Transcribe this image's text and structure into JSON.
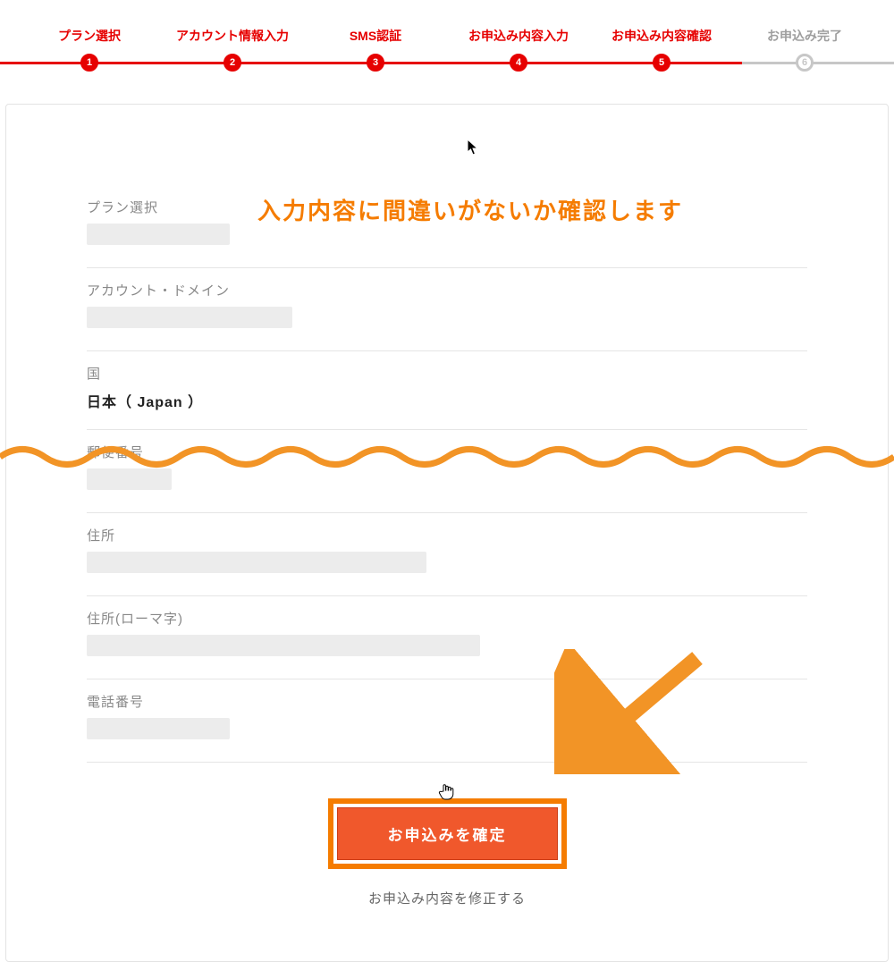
{
  "stepper": {
    "steps": [
      {
        "label": "プラン選択",
        "num": "1",
        "state": "active"
      },
      {
        "label": "アカウント情報入力",
        "num": "2",
        "state": "active"
      },
      {
        "label": "SMS認証",
        "num": "3",
        "state": "active"
      },
      {
        "label": "お申込み内容入力",
        "num": "4",
        "state": "active"
      },
      {
        "label": "お申込み内容確認",
        "num": "5",
        "state": "active"
      },
      {
        "label": "お申込み完了",
        "num": "6",
        "state": "inactive"
      }
    ]
  },
  "annotation": {
    "headline": "入力内容に間違いがないか確認します"
  },
  "form": {
    "plan": {
      "label": "プラン選択"
    },
    "domain": {
      "label": "アカウント・ドメイン"
    },
    "country": {
      "label": "国",
      "value": "日本（ Japan ）"
    },
    "zip": {
      "label": "郵便番号"
    },
    "address": {
      "label": "住所"
    },
    "address_r": {
      "label": "住所(ローマ字)"
    },
    "tel": {
      "label": "電話番号"
    }
  },
  "actions": {
    "confirm": "お申込みを確定",
    "modify": "お申込み内容を修正する"
  },
  "colors": {
    "accent_red": "#e60000",
    "accent_orange": "#f57c00",
    "button_orange": "#f0582c"
  }
}
